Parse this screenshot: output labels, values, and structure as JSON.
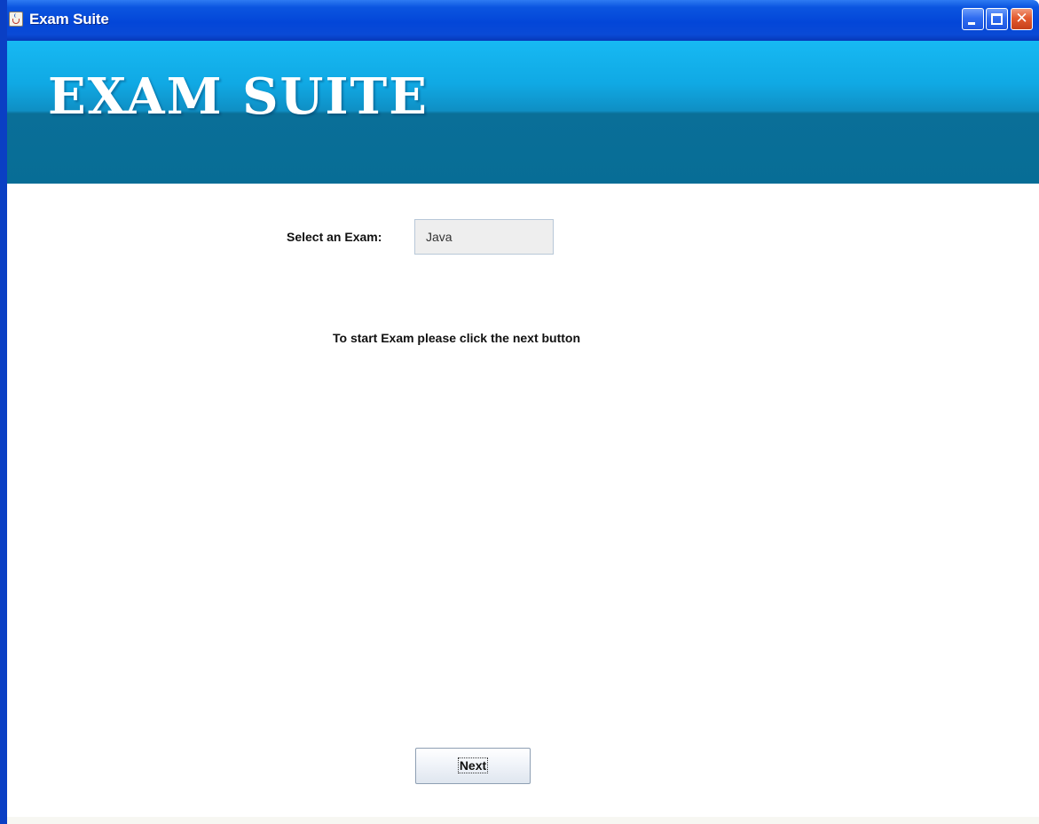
{
  "window": {
    "title": "Exam Suite",
    "icon": "java-cup-icon",
    "controls": {
      "minimize": "minimize-icon",
      "maximize": "maximize-icon",
      "close": "close-icon",
      "close_glyph": "✕"
    }
  },
  "banner": {
    "title": "EXAM SUITE"
  },
  "form": {
    "select_label": "Select an Exam:",
    "selected_exam": "Java",
    "instruction": "To start Exam please click the next button",
    "next_label": "Next"
  },
  "colors": {
    "titlebar": "#0346d8",
    "banner_top": "#17b9f3",
    "banner_bottom": "#076d96",
    "window_border": "#0a3fc4"
  }
}
